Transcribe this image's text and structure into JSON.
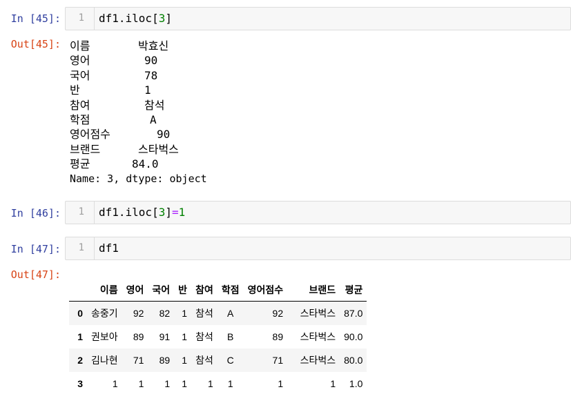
{
  "cells": {
    "c45": {
      "in_prompt": "In [45]:",
      "line_no": "1",
      "code": {
        "pre": "df1.iloc[",
        "num": "3",
        "post": "]"
      },
      "out_prompt": "Out[45]:",
      "series": [
        {
          "key": "이름",
          "value": "박효신"
        },
        {
          "key": "영어",
          "value": "90"
        },
        {
          "key": "국어",
          "value": "78"
        },
        {
          "key": "반",
          "value": "1"
        },
        {
          "key": "참여",
          "value": "참석"
        },
        {
          "key": "학점",
          "value": "A"
        },
        {
          "key": "영어점수",
          "value": "90"
        },
        {
          "key": "브랜드",
          "value": "스타벅스"
        },
        {
          "key": "평균",
          "value": "84.0"
        }
      ],
      "series_footer": "Name: 3, dtype: object"
    },
    "c46": {
      "in_prompt": "In [46]:",
      "line_no": "1",
      "code": {
        "pre": "df1.iloc[",
        "num": "3",
        "mid": "]",
        "op": "=",
        "num2": "1"
      }
    },
    "c47": {
      "in_prompt": "In [47]:",
      "line_no": "1",
      "code": "df1",
      "out_prompt": "Out[47]:",
      "table": {
        "columns": [
          "",
          "이름",
          "영어",
          "국어",
          "반",
          "참여",
          "학점",
          "영어점수",
          "브랜드",
          "평균"
        ],
        "rows": [
          [
            "0",
            "송중기",
            "92",
            "82",
            "1",
            "참석",
            "A",
            "92",
            "스타벅스",
            "87.0"
          ],
          [
            "1",
            "권보아",
            "89",
            "91",
            "1",
            "참석",
            "B",
            "89",
            "스타벅스",
            "90.0"
          ],
          [
            "2",
            "김나현",
            "71",
            "89",
            "1",
            "참석",
            "C",
            "71",
            "스타벅스",
            "80.0"
          ],
          [
            "3",
            "1",
            "1",
            "1",
            "1",
            "1",
            "1",
            "1",
            "1",
            "1.0"
          ]
        ]
      }
    }
  },
  "colors": {
    "in_prompt": "#303f9f",
    "out_prompt": "#d84315",
    "number": "#008000",
    "operator": "#aa22ff"
  }
}
